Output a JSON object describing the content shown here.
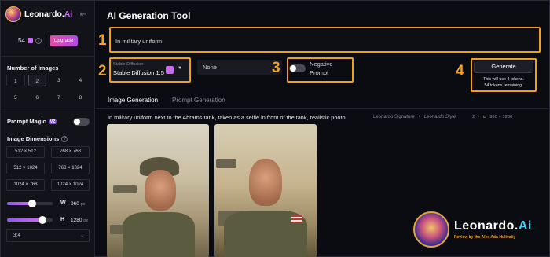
{
  "brand": {
    "name": "Leonardo.",
    "ai_suffix": "Ai"
  },
  "sidebar": {
    "tokens": "54",
    "upgrade_label": "Upgrade",
    "number_of_images": {
      "label": "Number of Images",
      "options": [
        "1",
        "2",
        "3",
        "4",
        "5",
        "6",
        "7",
        "8"
      ],
      "selected": "2"
    },
    "prompt_magic": {
      "label": "Prompt Magic",
      "badge": "V2",
      "enabled": false
    },
    "image_dimensions": {
      "label": "Image Dimensions",
      "options": [
        "512 × 512",
        "768 × 768",
        "512 × 1024",
        "768 × 1024",
        "1024 × 768",
        "1024 × 1024"
      ]
    },
    "width": {
      "label": "W",
      "value": "960",
      "unit": "px",
      "fraction": 0.55
    },
    "height": {
      "label": "H",
      "value": "1280",
      "unit": "px",
      "fraction": 0.78
    },
    "aspect_ratio": "3:4"
  },
  "main": {
    "title": "AI Generation Tool",
    "annotations": [
      "1",
      "2",
      "3",
      "4"
    ],
    "prompt": "In military uniform",
    "model": {
      "sub_label": "Stable Diffusion",
      "value": "Stable Diffusion 1.5"
    },
    "style_field": "None",
    "negative_prompt": {
      "label": "Negative Prompt",
      "enabled": false
    },
    "generate": {
      "label": "Generate",
      "info_line1": "This will use 4 tokens.",
      "info_line2": "54 tokens remaining."
    },
    "tabs": [
      {
        "label": "Image Generation",
        "active": true
      },
      {
        "label": "Prompt Generation",
        "active": false
      }
    ],
    "generation": {
      "prompt": "In military uniform next to the Abrams tank, taken as a selfie in front of the tank, realistic photo",
      "model": "Leonardo Signature",
      "style": "Leonardo Style",
      "count": "2",
      "size": "960 × 1280"
    }
  },
  "watermark": {
    "title": "Leonardo.",
    "title_suffix": "Ai",
    "subtitle": "Review by the Alex Ada-Hulivatiy"
  },
  "colors": {
    "accent": "#c86cf0",
    "annotation": "#f0a020",
    "background": "#0b0b12"
  }
}
